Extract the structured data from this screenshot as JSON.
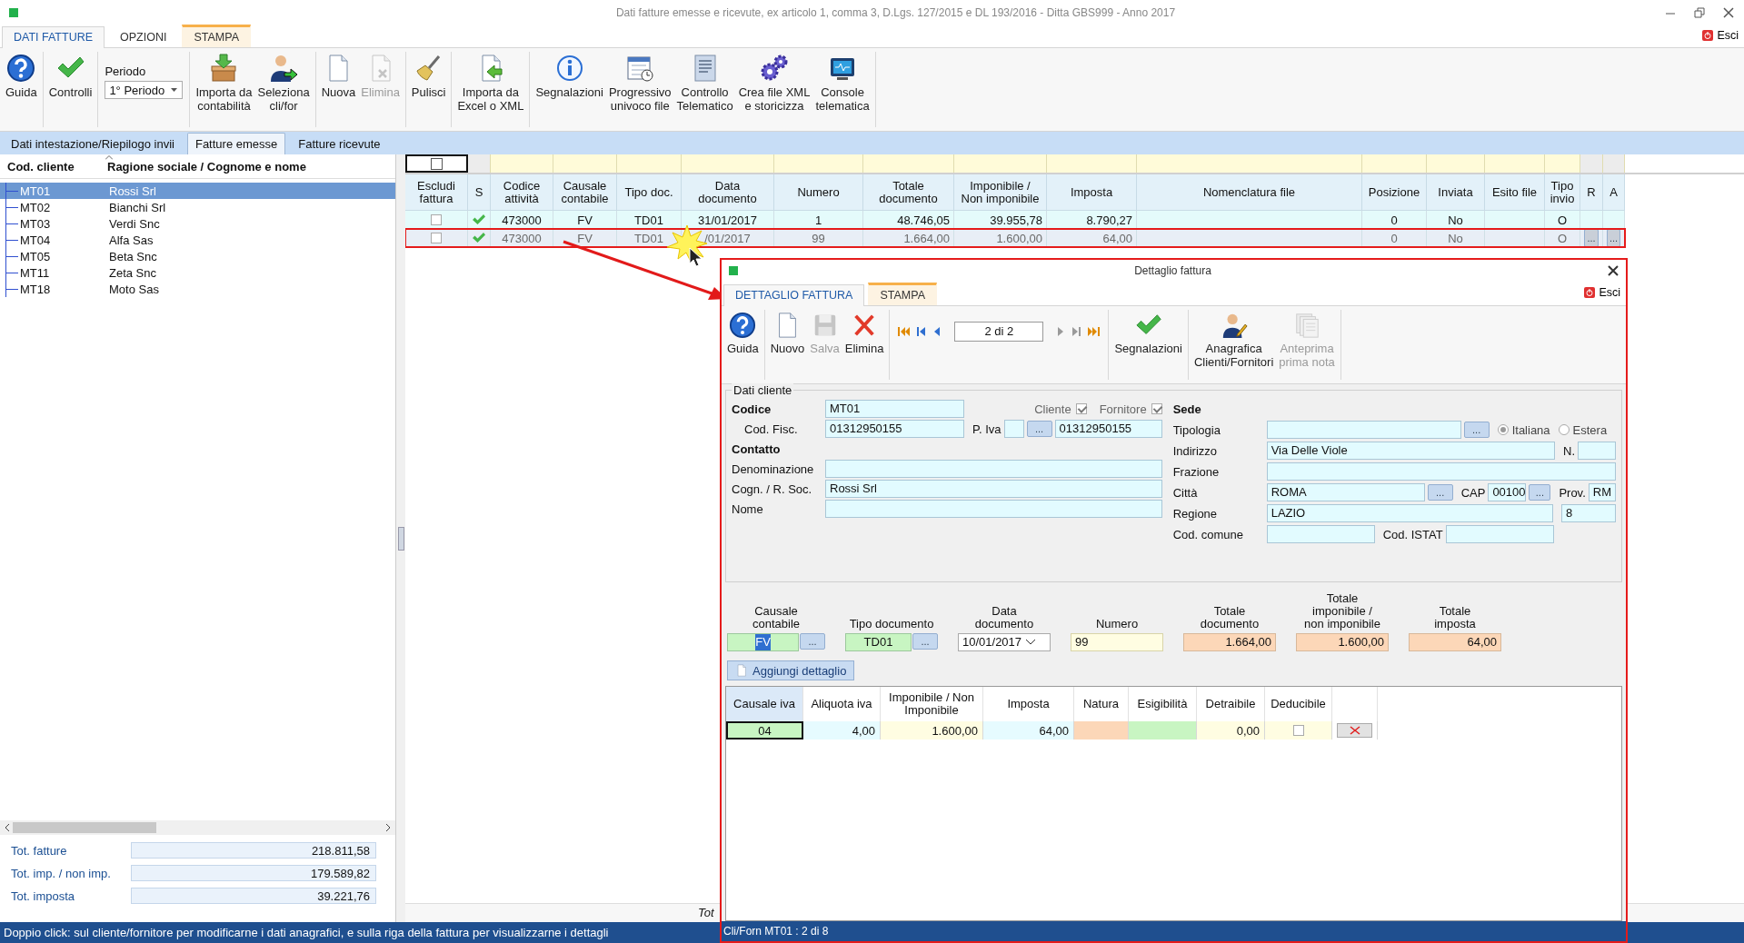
{
  "window": {
    "title": "Dati fatture emesse e ricevute, ex articolo 1, comma 3, D.Lgs. 127/2015 e DL 193/2016 - Ditta GBS999 - Anno 2017"
  },
  "ribbon_tabs": [
    {
      "label": "DATI FATTURE",
      "selected": true,
      "contextual": false
    },
    {
      "label": "OPZIONI",
      "selected": false,
      "contextual": false
    },
    {
      "label": "STAMPA",
      "selected": false,
      "contextual": true
    }
  ],
  "exit": "Esci",
  "ribbon": [
    {
      "items": [
        {
          "kind": "button",
          "label": "Guida",
          "disabled": false
        }
      ]
    },
    {
      "items": [
        {
          "kind": "button",
          "label": "Controlli",
          "disabled": false
        }
      ]
    },
    {
      "items": [
        {
          "kind": "dropdown",
          "label": "Periodo",
          "value": "1° Periodo"
        }
      ]
    },
    {
      "items": [
        {
          "kind": "button",
          "label": "Importa da\ncontabilità",
          "disabled": false
        },
        {
          "kind": "button",
          "label": "Seleziona\ncli/for",
          "disabled": false
        }
      ]
    },
    {
      "items": [
        {
          "kind": "button",
          "label": "Nuova",
          "disabled": false
        },
        {
          "kind": "button",
          "label": "Elimina",
          "disabled": true
        }
      ]
    },
    {
      "items": [
        {
          "kind": "button",
          "label": "Pulisci",
          "disabled": false
        }
      ]
    },
    {
      "items": [
        {
          "kind": "button",
          "label": "Importa da\nExcel o XML",
          "disabled": false
        }
      ]
    },
    {
      "items": [
        {
          "kind": "button",
          "label": "Segnalazioni",
          "disabled": false
        },
        {
          "kind": "button",
          "label": "Progressivo\nunivoco file",
          "disabled": false
        },
        {
          "kind": "button",
          "label": "Controllo\nTelematico",
          "disabled": false
        },
        {
          "kind": "button",
          "label": "Crea file XML\ne storicizza",
          "disabled": false
        },
        {
          "kind": "button",
          "label": "Console\ntelematica",
          "disabled": false
        }
      ]
    }
  ],
  "subtabs": [
    {
      "label": "Dati intestazione/Riepilogo invii",
      "selected": false
    },
    {
      "label": "Fatture emesse",
      "selected": true
    },
    {
      "label": "Fatture ricevute",
      "selected": false
    }
  ],
  "clients": {
    "columns": [
      "Cod. cliente",
      "Ragione sociale / Cognome e nome"
    ],
    "rows": [
      {
        "code": "MT01",
        "name": "Rossi Srl",
        "selected": true
      },
      {
        "code": "MT02",
        "name": "Bianchi Srl",
        "selected": false
      },
      {
        "code": "MT03",
        "name": "Verdi Snc",
        "selected": false
      },
      {
        "code": "MT04",
        "name": "Alfa Sas",
        "selected": false
      },
      {
        "code": "MT05",
        "name": "Beta Snc",
        "selected": false
      },
      {
        "code": "MT11",
        "name": "Zeta Snc",
        "selected": false
      },
      {
        "code": "MT18",
        "name": "Moto Sas",
        "selected": false
      }
    ],
    "totals": [
      {
        "label": "Tot. fatture",
        "value": "218.811,58"
      },
      {
        "label": "Tot. imp. / non imp.",
        "value": "179.589,82"
      },
      {
        "label": "Tot. imposta",
        "value": "39.221,76"
      }
    ]
  },
  "grid": {
    "filter_checked": false,
    "columns": [
      "Escludi\nfattura",
      "S",
      "Codice\nattività",
      "Causale\ncontabile",
      "Tipo doc.",
      "Data\ndocumento",
      "Numero",
      "Totale\ndocumento",
      "Imponibile /\nNon imponibile",
      "Imposta",
      "Nomenclatura file",
      "Posizione",
      "Inviata",
      "Esito file",
      "Tipo\ninvio",
      "R",
      "A"
    ],
    "rows": [
      {
        "excluded": false,
        "signal": true,
        "selected": false,
        "outlined": false,
        "codice": "473000",
        "causale": "FV",
        "tipo": "TD01",
        "data": "31/01/2017",
        "numero": "1",
        "totale": "48.746,05",
        "imponibile": "39.955,78",
        "imposta": "8.790,27",
        "posizione": "0",
        "inviata": "No",
        "tipo_invio": "O"
      },
      {
        "excluded": false,
        "signal": true,
        "selected": true,
        "outlined": true,
        "codice": "473000",
        "causale": "FV",
        "tipo": "TD01",
        "data": "/01/2017",
        "numero": "99",
        "totale": "1.664,00",
        "imponibile": "1.600,00",
        "imposta": "64,00",
        "posizione": "0",
        "inviata": "No",
        "tipo_invio": "O",
        "r": "...",
        "a": "..."
      }
    ],
    "footer": "Tot"
  },
  "dialog": {
    "title": "Dettaglio fattura",
    "outlined": true,
    "tabs": [
      {
        "label": "DETTAGLIO FATTURA",
        "selected": true,
        "contextual": false
      },
      {
        "label": "STAMPA",
        "selected": false,
        "contextual": true
      }
    ],
    "exit": "Esci",
    "toolbar": [
      {
        "items": [
          {
            "kind": "button",
            "label": "Guida",
            "disabled": false
          }
        ]
      },
      {
        "items": [
          {
            "kind": "button",
            "label": "Nuovo",
            "disabled": false
          },
          {
            "kind": "button",
            "label": "Salva",
            "disabled": true
          },
          {
            "kind": "button",
            "label": "Elimina",
            "disabled": false
          }
        ]
      },
      {
        "items": [
          {
            "kind": "navigator",
            "value": "2 di 2",
            "forward_disabled": true
          }
        ]
      },
      {
        "items": [
          {
            "kind": "button",
            "label": "Segnalazioni",
            "disabled": false
          }
        ]
      },
      {
        "items": [
          {
            "kind": "button",
            "label": "Anagrafica\nClienti/Fornitori",
            "disabled": false
          },
          {
            "kind": "button",
            "label": "Anteprima\nprima nota",
            "disabled": true
          }
        ]
      }
    ],
    "cliente": {
      "legend": "Dati cliente",
      "codice": {
        "label": "Codice",
        "value": "MT01"
      },
      "flags": [
        {
          "label": "Cliente",
          "checked": true
        },
        {
          "label": "Fornitore",
          "checked": true
        }
      ],
      "cod_fisc": {
        "label": "Cod. Fisc.",
        "value": "01312950155"
      },
      "p_iva": {
        "label": "P. Iva",
        "button": "...",
        "value": "01312950155"
      },
      "contatto": "Contatto",
      "contact_fields": [
        {
          "label": "Denominazione"
        },
        {
          "label": "Cogn. / R. Soc.",
          "value": "Rossi Srl"
        },
        {
          "label": "Nome"
        }
      ],
      "sede": "Sede",
      "tipologia": {
        "label": "Tipologia",
        "button": "..."
      },
      "origin": [
        {
          "label": "Italiana",
          "selected": true
        },
        {
          "label": "Estera",
          "selected": false
        }
      ],
      "indirizzo": {
        "label": "Indirizzo",
        "value": "Via Delle Viole"
      },
      "numero": {
        "label": "N."
      },
      "frazione": {
        "label": "Frazione"
      },
      "citta": {
        "label": "Città",
        "value": "ROMA",
        "button": "..."
      },
      "cap": {
        "label": "CAP",
        "value": "00100",
        "button": "..."
      },
      "prov": {
        "label": "Prov.",
        "value": "RM"
      },
      "regione": {
        "label": "Regione",
        "value": "LAZIO"
      },
      "regione_code": {
        "value": "8"
      },
      "cod_comune": {
        "label": "Cod. comune"
      },
      "cod_istat": {
        "label": "Cod. ISTAT"
      }
    },
    "document": [
      {
        "label": "Causale\ncontabile",
        "value": "FV",
        "kind": "lookup",
        "button": "...",
        "text_selected": true
      },
      {
        "label": "Tipo documento",
        "value": "TD01",
        "kind": "lookup",
        "button": "...",
        "text_selected": false
      },
      {
        "label": "Data\ndocumento",
        "value": "10/01/2017",
        "kind": "date",
        "text_selected": false
      },
      {
        "label": "Numero",
        "value": "99",
        "kind": "input",
        "text_selected": false
      },
      {
        "label": "Totale\ndocumento",
        "value": "1.664,00",
        "kind": "total",
        "text_selected": false
      },
      {
        "label": "Totale\nimponibile /\nnon imponibile",
        "value": "1.600,00",
        "kind": "total",
        "text_selected": false
      },
      {
        "label": "Totale\nimposta",
        "value": "64,00",
        "kind": "total",
        "text_selected": false
      }
    ],
    "add_detail": "Aggiungi dettaglio",
    "details": {
      "columns": [
        {
          "label": "Causale iva",
          "selected": true
        },
        {
          "label": "Aliquota iva",
          "selected": false
        },
        {
          "label": "Imponibile / Non\nImponibile",
          "selected": false
        },
        {
          "label": "Imposta",
          "selected": false
        },
        {
          "label": "Natura",
          "selected": false
        },
        {
          "label": "Esigibilità",
          "selected": false
        },
        {
          "label": "Detraibile",
          "selected": false
        },
        {
          "label": "Deducibile",
          "selected": false
        }
      ],
      "rows": [
        {
          "deducibile": false,
          "cells": [
            {
              "value": "04",
              "kind": "lookup",
              "focused": true
            },
            {
              "value": "4,00",
              "kind": "computed",
              "focused": false
            },
            {
              "value": "1.600,00",
              "kind": "input",
              "focused": false
            },
            {
              "value": "64,00",
              "kind": "computed",
              "focused": false
            },
            {
              "kind": "choice",
              "focused": false
            },
            {
              "kind": "lookup",
              "focused": false
            },
            {
              "value": "0,00",
              "kind": "input",
              "focused": false
            }
          ]
        }
      ]
    },
    "status": "Cli/Forn MT01 : 2 di 8"
  },
  "status_bar": "Doppio click: sul cliente/fornitore per modificarne i dati anagrafici, e sulla riga della fattura per visualizzarne i dettagli"
}
